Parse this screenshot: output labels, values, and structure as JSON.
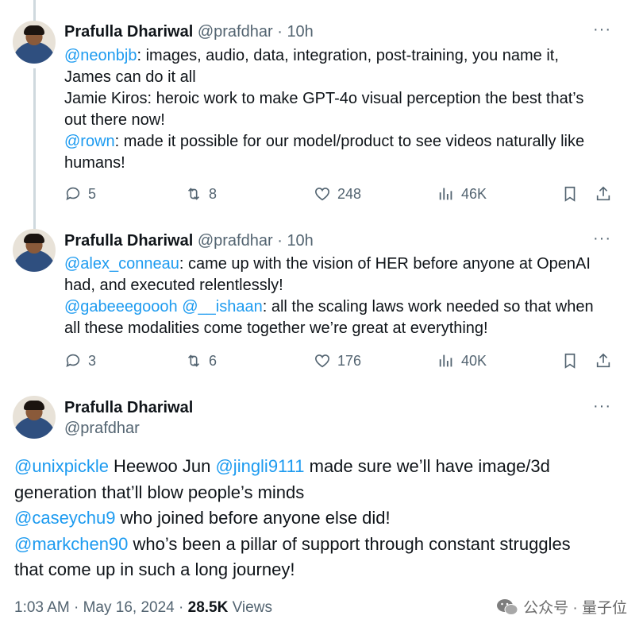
{
  "tweets": [
    {
      "name": "Prafulla Dhariwal",
      "handle": "@prafdhar",
      "sep": "·",
      "time": "10h",
      "more": "···",
      "lines": [
        {
          "mention": "@neonbjb",
          "text": ": images, audio, data, integration, post-training, you name it,"
        },
        {
          "mention": "",
          "text": "James can do it all"
        },
        {
          "mention": "",
          "text": "Jamie Kiros: heroic work to make GPT-4o visual perception the best that’s"
        },
        {
          "mention": "",
          "text": "out there now!"
        },
        {
          "mention": "@rown",
          "text": ": made it possible for our model/product to see videos naturally like"
        },
        {
          "mention": "",
          "text": "humans!"
        }
      ],
      "replies": "5",
      "reposts": "8",
      "likes": "248",
      "views": "46K"
    },
    {
      "name": "Prafulla Dhariwal",
      "handle": "@prafdhar",
      "sep": "·",
      "time": "10h",
      "more": "···",
      "lines": [
        {
          "mention": "@alex_conneau",
          "text": ": came up with the vision of HER before anyone at OpenAI"
        },
        {
          "mention": "",
          "text": "had, and executed relentlessly!"
        },
        {
          "mention": "@gabeeegoooh @__ishaan",
          "text": ": all the scaling laws work needed so that when"
        },
        {
          "mention": "",
          "text": "all these modalities come together we’re great at everything!"
        }
      ],
      "replies": "3",
      "reposts": "6",
      "likes": "176",
      "views": "40K"
    }
  ],
  "main": {
    "name": "Prafulla Dhariwal",
    "handle": "@prafdhar",
    "more": "···",
    "line1_m1": "@unixpickle",
    "line1_t1": " Heewoo Jun ",
    "line1_m2": "@jingli9111",
    "line1_t2": " made sure we’ll have image/3d",
    "line2": "generation that’ll blow people’s minds",
    "line3_m": "@caseychu9",
    "line3_t": " who joined before anyone else did!",
    "line4_m": "@markchen90",
    "line4_t": " who’s been a pillar of support through constant struggles",
    "line5": "that come up in such a long journey!",
    "time": "1:03 AM · May 16, 2024 · ",
    "views_count": "28.5K",
    "views_label": " Views"
  },
  "watermark": {
    "text": "公众号 · 量子位"
  }
}
